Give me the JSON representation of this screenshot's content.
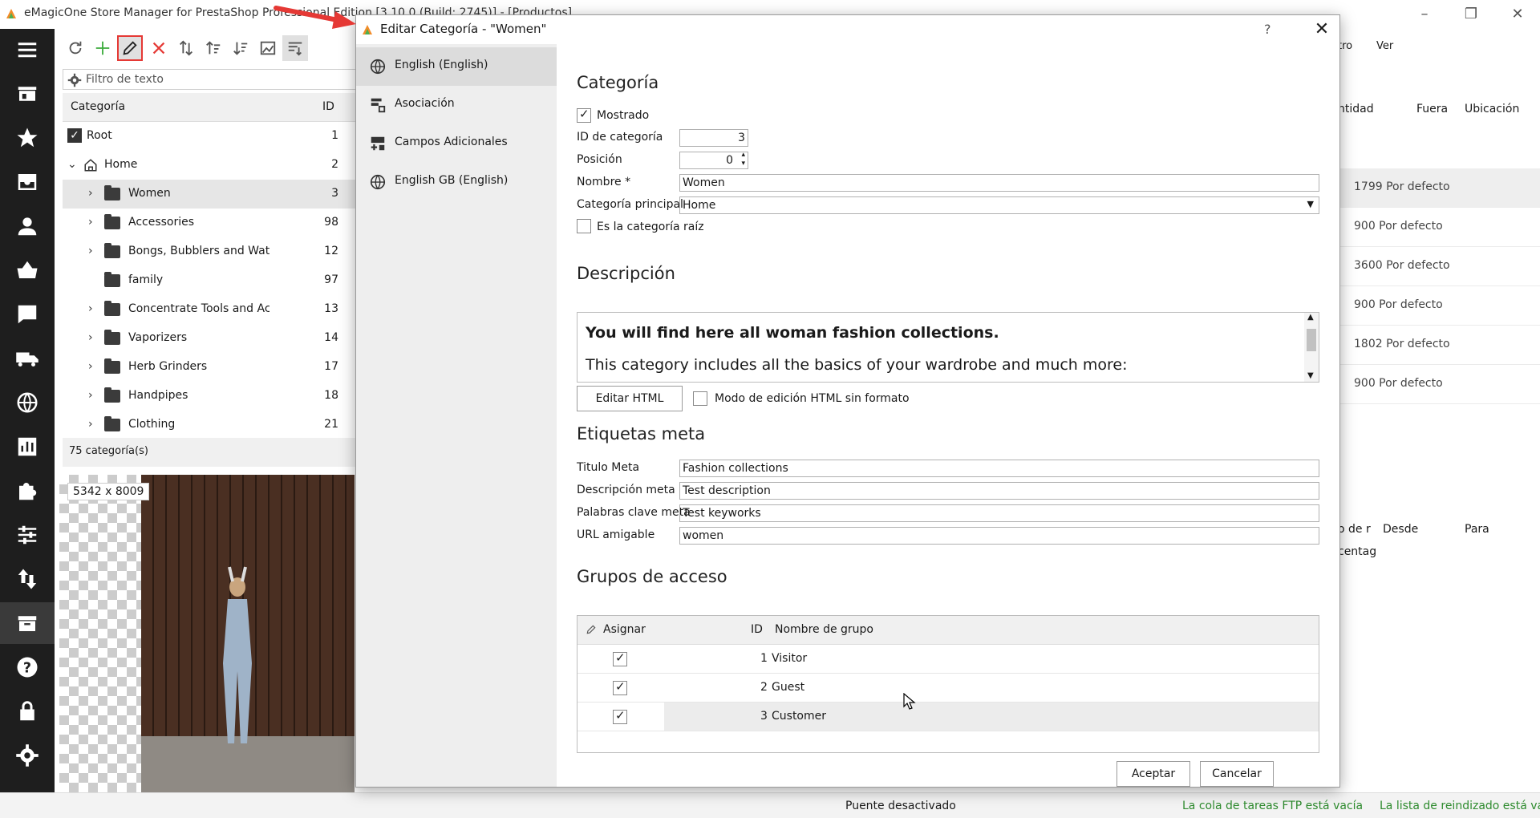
{
  "app": {
    "title": "eMagicOne Store Manager for PrestaShop Professional Edition [3.10.0 (Build: 2745)] - [Productos]",
    "accent": "#e53935"
  },
  "nav": [
    "menu-icon",
    "store-icon",
    "star-icon",
    "inbox-icon",
    "user-icon",
    "basket-icon",
    "chat-icon",
    "truck-icon",
    "globe-icon",
    "chart-icon",
    "puzzle-icon",
    "sliders-icon",
    "transfer-icon",
    "box-icon",
    "help-icon",
    "lock-icon",
    "gear-icon"
  ],
  "categories": {
    "filter_placeholder": "Filtro de texto",
    "col_category": "Categoría",
    "col_id": "ID",
    "rows": [
      {
        "name": "Root",
        "id": "1"
      },
      {
        "name": "Home",
        "id": "2"
      },
      {
        "name": "Women",
        "id": "3"
      },
      {
        "name": "Accessories",
        "id": "98"
      },
      {
        "name": "Bongs, Bubblers and Water",
        "id": "12"
      },
      {
        "name": "family",
        "id": "97"
      },
      {
        "name": "Concentrate Tools and Acc",
        "id": "13"
      },
      {
        "name": "Vaporizers",
        "id": "14"
      },
      {
        "name": "Herb Grinders",
        "id": "17"
      },
      {
        "name": "Handpipes",
        "id": "18"
      },
      {
        "name": "Clothing",
        "id": "21"
      }
    ],
    "count": "75 categoría(s)"
  },
  "image": {
    "size": "5342 x 8009"
  },
  "background_grid": {
    "toolbar": {
      "filter": "tro",
      "view": "Ver"
    },
    "headers": {
      "qty": "ntidad",
      "out": "Fuera",
      "location": "Ubicación"
    },
    "rows": [
      {
        "qty": "1799 Por defecto"
      },
      {
        "qty": "900 Por defecto"
      },
      {
        "qty": "3600 Por defecto"
      },
      {
        "qty": "900 Por defecto"
      },
      {
        "qty": "1802 Por defecto"
      },
      {
        "qty": "900 Por defecto"
      }
    ],
    "lower_headers": {
      "a": "o de r",
      "from": "Desde",
      "to": "Para"
    },
    "lower_cell": "centag"
  },
  "status": {
    "bridge": "Puente desactivado",
    "ftp": "La cola de tareas FTP está vacía",
    "reindex": "La lista de reindizado está vacía",
    "ok_color": "#2e8b2e"
  },
  "dialog": {
    "title": "Editar Categoría - \"Women\"",
    "help": "?",
    "nav": [
      {
        "label": "English (English)",
        "icon": "globe-icon"
      },
      {
        "label": "Asociación",
        "icon": "association-icon"
      },
      {
        "label": "Campos Adicionales",
        "icon": "add-fields-icon"
      },
      {
        "label": "English GB (English)",
        "icon": "globe-icon"
      }
    ],
    "category": {
      "title": "Categoría",
      "shown_label": "Mostrado",
      "shown": true,
      "id_label": "ID de categoría",
      "id_value": "3",
      "position_label": "Posición",
      "position_value": "0",
      "name_label": "Nombre *",
      "name_value": "Women",
      "parent_label": "Categoría principal",
      "parent_value": "Home",
      "root_label": "Es la categoría raíz",
      "root": false
    },
    "description": {
      "title": "Descripción",
      "bold": "You will find here all woman fashion collections.",
      "text": "This category includes all the basics of your wardrobe and much more:",
      "edit_html": "Editar HTML",
      "raw_mode_label": "Modo de edición HTML sin formato"
    },
    "meta": {
      "title": "Etiquetas meta",
      "meta_title_label": "Titulo Meta",
      "meta_title": "Fashion collections",
      "meta_desc_label": "Descripción meta",
      "meta_desc": "Test description",
      "keywords_label": "Palabras clave meta",
      "keywords": "Test keyworks",
      "url_label": "URL amigable",
      "url": "women"
    },
    "groups": {
      "title": "Grupos de acceso",
      "col_assign": "Asignar",
      "col_id": "ID",
      "col_name": "Nombre de grupo",
      "rows": [
        {
          "id": "1",
          "name": "Visitor",
          "checked": true
        },
        {
          "id": "2",
          "name": "Guest",
          "checked": true
        },
        {
          "id": "3",
          "name": "Customer",
          "checked": true
        }
      ]
    },
    "ok": "Aceptar",
    "cancel": "Cancelar"
  }
}
